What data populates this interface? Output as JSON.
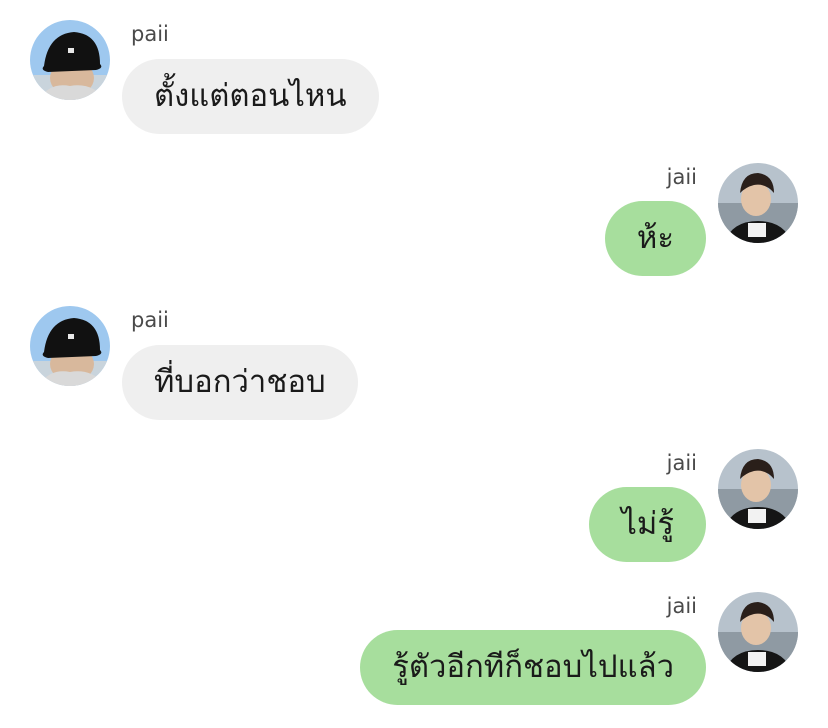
{
  "colors": {
    "incoming_bubble": "#efefef",
    "outgoing_bubble": "#a7de9d",
    "background": "#ffffff"
  },
  "messages": [
    {
      "side": "incoming",
      "sender": "paii",
      "text": "ตั้งแต่ตอนไหน",
      "avatar_icon": "person-bucket-hat-avatar"
    },
    {
      "side": "outgoing",
      "sender": "jaii",
      "text": "ห้ะ",
      "avatar_icon": "person-smiling-avatar"
    },
    {
      "side": "incoming",
      "sender": "paii",
      "text": "ที่บอกว่าชอบ",
      "avatar_icon": "person-bucket-hat-avatar"
    },
    {
      "side": "outgoing",
      "sender": "jaii",
      "text": "ไม่รู้",
      "avatar_icon": "person-smiling-avatar"
    },
    {
      "side": "outgoing",
      "sender": "jaii",
      "text": "รู้ตัวอีกทีก็ชอบไปแล้ว",
      "avatar_icon": "person-smiling-avatar"
    }
  ]
}
